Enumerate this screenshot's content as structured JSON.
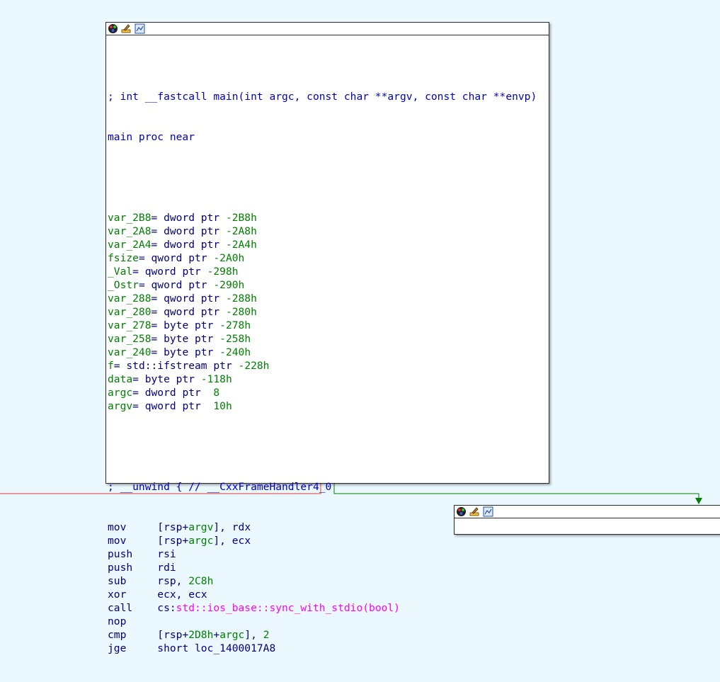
{
  "graph": {
    "main_node": {
      "header_icons": [
        "color-palette-icon",
        "rename-pencil-icon",
        "graph-overview-icon"
      ],
      "code": {
        "signature": "; int __fastcall main(int argc, const char **argv, const char **envp)",
        "proc": "main proc near",
        "vars": [
          {
            "name": "var_2B8",
            "type": "dword ptr",
            "offset": "-2B8h"
          },
          {
            "name": "var_2A8",
            "type": "dword ptr",
            "offset": "-2A8h"
          },
          {
            "name": "var_2A4",
            "type": "dword ptr",
            "offset": "-2A4h"
          },
          {
            "name": "fsize",
            "type": "qword ptr",
            "offset": "-2A0h"
          },
          {
            "name": "_Val",
            "type": "qword ptr",
            "offset": "-298h"
          },
          {
            "name": "_Ostr",
            "type": "qword ptr",
            "offset": "-290h"
          },
          {
            "name": "var_288",
            "type": "qword ptr",
            "offset": "-288h"
          },
          {
            "name": "var_280",
            "type": "qword ptr",
            "offset": "-280h"
          },
          {
            "name": "var_278",
            "type": "byte ptr",
            "offset": "-278h"
          },
          {
            "name": "var_258",
            "type": "byte ptr",
            "offset": "-258h"
          },
          {
            "name": "var_240",
            "type": "byte ptr",
            "offset": "-240h"
          },
          {
            "name": "f",
            "type": "std::ifstream ptr",
            "offset": "-228h"
          },
          {
            "name": "data",
            "type": "byte ptr",
            "offset": "-118h"
          },
          {
            "name": "argc",
            "type": "dword ptr",
            "offset": " 8"
          },
          {
            "name": "argv",
            "type": "qword ptr",
            "offset": " 10h"
          }
        ],
        "unwind_comment": "; __unwind { // __CxxFrameHandler4_0",
        "instructions": [
          {
            "mnemonic": "mov",
            "op_pre": "[rsp+",
            "op_num": "argv",
            "op_post": "], rdx"
          },
          {
            "mnemonic": "mov",
            "op_pre": "[rsp+",
            "op_num": "argc",
            "op_post": "], ecx"
          },
          {
            "mnemonic": "push",
            "op_pre": "rsi",
            "op_num": "",
            "op_post": ""
          },
          {
            "mnemonic": "push",
            "op_pre": "rdi",
            "op_num": "",
            "op_post": ""
          },
          {
            "mnemonic": "sub",
            "op_pre": "rsp, ",
            "op_num": "2C8h",
            "op_post": ""
          },
          {
            "mnemonic": "xor",
            "op_pre": "ecx, ecx",
            "op_num": "",
            "op_post": ""
          },
          {
            "mnemonic": "call",
            "op_pre": "cs:",
            "op_ext": "std::ios_base::sync_with_stdio(bool)",
            "op_num": "",
            "op_post": ""
          },
          {
            "mnemonic": "nop",
            "op_pre": "",
            "op_num": "",
            "op_post": ""
          },
          {
            "mnemonic": "cmp",
            "op_pre": "[rsp+",
            "op_num": "2D8h",
            "op_mid": "+",
            "op_num2": "argc",
            "op_post": "], ",
            "op_num3": "2"
          },
          {
            "mnemonic": "jge",
            "op_pre": "short loc_1400017A8",
            "op_num": "",
            "op_post": ""
          }
        ]
      }
    },
    "second_node": {
      "header_icons": [
        "color-palette-icon",
        "rename-pencil-icon",
        "graph-overview-icon"
      ]
    },
    "colors": {
      "background": "#ebf8fe",
      "false_edge": "#ff0000",
      "true_edge": "#008000"
    }
  }
}
